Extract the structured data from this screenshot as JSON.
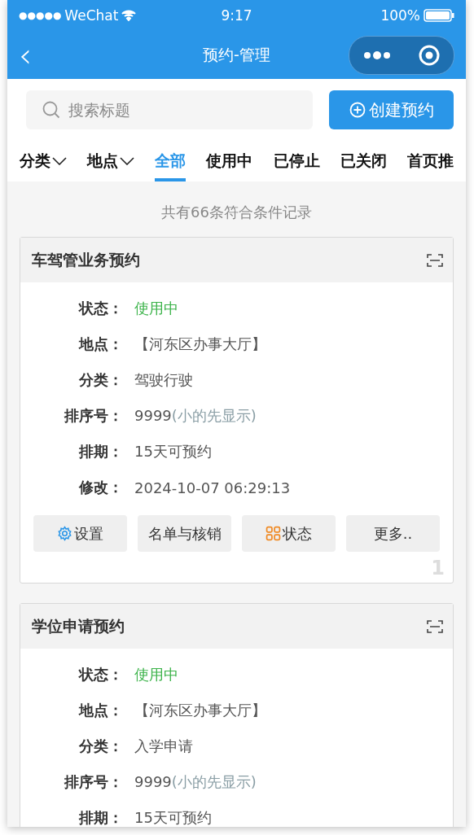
{
  "status_bar": {
    "signal_dots": "●●●●●",
    "carrier": "WeChat",
    "time": "9:17",
    "battery": "100%"
  },
  "nav": {
    "back": "‹",
    "title": "预约-管理"
  },
  "search": {
    "placeholder": "搜索标题"
  },
  "create_button": {
    "label": "创建预约"
  },
  "tabs": [
    {
      "label": "分类",
      "kind": "dropdown",
      "selected": false
    },
    {
      "label": "地点",
      "kind": "dropdown",
      "selected": false
    },
    {
      "label": "全部",
      "kind": "tab",
      "selected": true
    },
    {
      "label": "使用中",
      "kind": "tab",
      "selected": false
    },
    {
      "label": "已停止",
      "kind": "tab",
      "selected": false
    },
    {
      "label": "已关闭",
      "kind": "tab",
      "selected": false
    },
    {
      "label": "首页推",
      "kind": "tab",
      "selected": false
    }
  ],
  "summary": "共有66条符合条件记录",
  "cards": [
    {
      "title": "车驾管业务预约",
      "index": "1",
      "fields": [
        {
          "label": "状态：",
          "kind": "status",
          "value": "使用中"
        },
        {
          "label": "地点：",
          "kind": "plain",
          "value": "【河东区办事大厅】"
        },
        {
          "label": "分类：",
          "kind": "plain",
          "value": "驾驶行驶"
        },
        {
          "label": "排序号：",
          "kind": "sort",
          "value": "9999",
          "hint": "(小的先显示)"
        },
        {
          "label": "排期：",
          "kind": "plain",
          "value": "15天可预约"
        },
        {
          "label": "修改：",
          "kind": "plain",
          "value": "2024-10-07 06:29:13"
        }
      ],
      "actions": [
        {
          "label": "设置",
          "kind": "gear"
        },
        {
          "label": "名单与核销",
          "kind": "plain"
        },
        {
          "label": "状态",
          "kind": "grid"
        },
        {
          "label": "更多..",
          "kind": "plain"
        }
      ]
    },
    {
      "title": "学位申请预约",
      "fields": [
        {
          "label": "状态：",
          "kind": "status",
          "value": "使用中"
        },
        {
          "label": "地点：",
          "kind": "plain",
          "value": "【河东区办事大厅】"
        },
        {
          "label": "分类：",
          "kind": "plain",
          "value": "入学申请"
        },
        {
          "label": "排序号：",
          "kind": "sort",
          "value": "9999",
          "hint": "(小的先显示)"
        },
        {
          "label": "排期：",
          "kind": "plain",
          "value": "15天可预约"
        }
      ]
    }
  ]
}
